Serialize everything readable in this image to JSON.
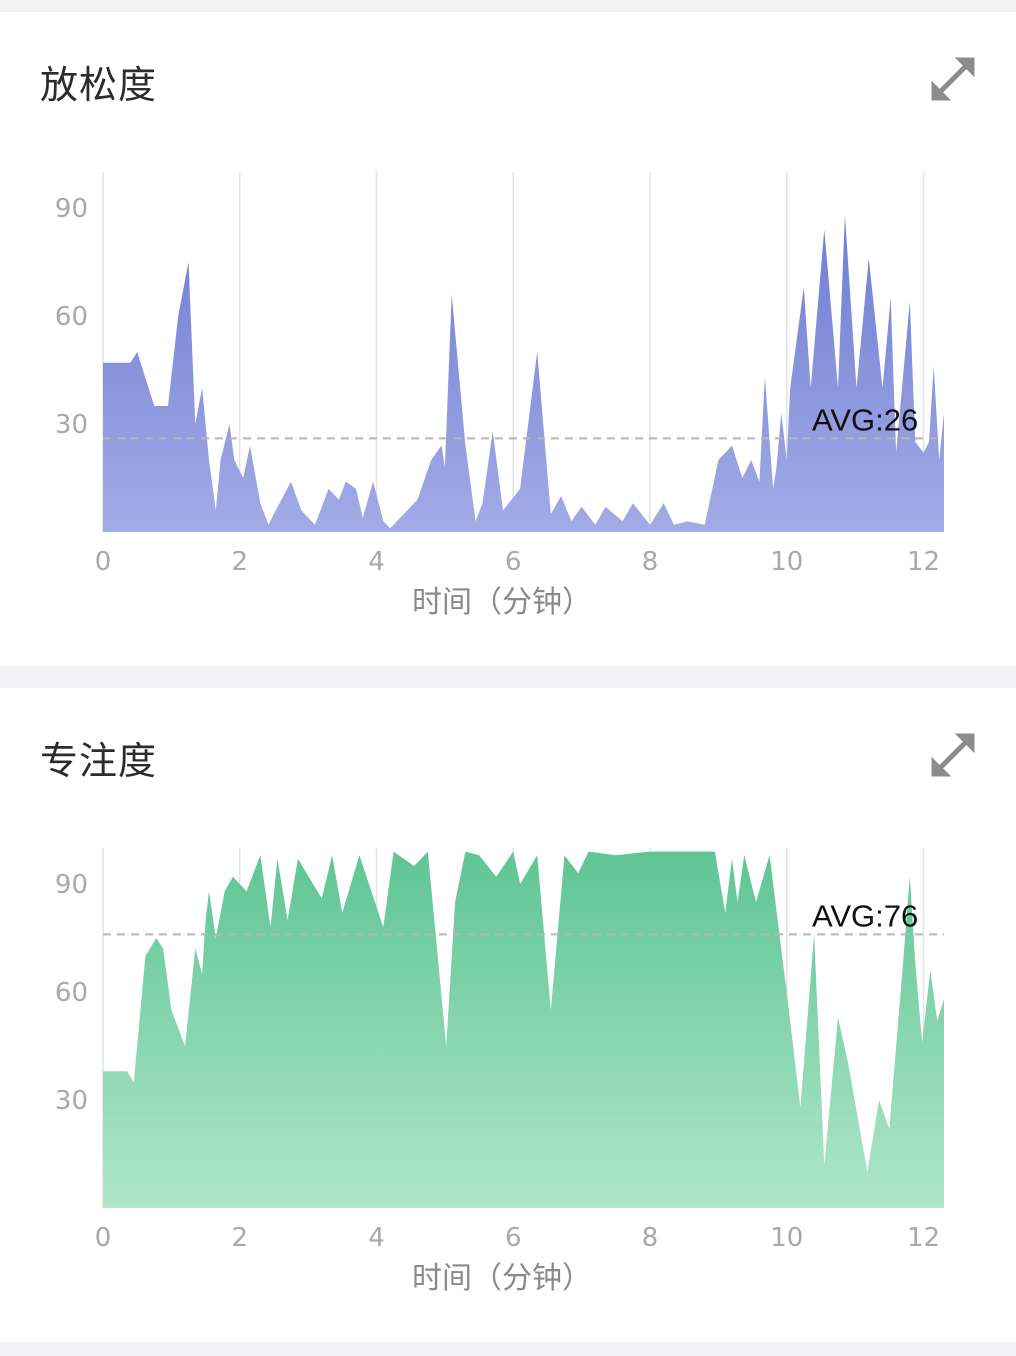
{
  "colors": {
    "relax_top": "#6f7dd3",
    "relax_bottom": "#a3abe5",
    "focus_top": "#5fc595",
    "focus_bottom": "#b0e6cb",
    "avg_line": "#b5b5b5",
    "grid": "#e3e3e3"
  },
  "cards": [
    {
      "title": "放松度",
      "expand_icon": "expand-arrows-icon",
      "chart_data": {
        "type": "area",
        "xlabel": "时间（分钟）",
        "ylabel": "",
        "xlim": [
          0,
          12.3
        ],
        "ylim": [
          0,
          100
        ],
        "xticks": [
          0,
          2,
          4,
          6,
          8,
          10,
          12
        ],
        "yticks": [
          30,
          60,
          90
        ],
        "avg_label": "AVG:26",
        "avg": 26,
        "series": [
          {
            "x": [
              0,
              0.4,
              0.5,
              0.75,
              0.95,
              1.1,
              1.25,
              1.35,
              1.45,
              1.55,
              1.65,
              1.72,
              1.85,
              1.92,
              2.05,
              2.15,
              2.3,
              2.42,
              2.5,
              2.75,
              2.9,
              3.1,
              3.3,
              3.45,
              3.55,
              3.7,
              3.8,
              3.95,
              4.1,
              4.2,
              4.35,
              4.6,
              4.8,
              4.95,
              5.0,
              5.1,
              5.3,
              5.45,
              5.55,
              5.7,
              5.85,
              6.1,
              6.35,
              6.55,
              6.7,
              6.85,
              7.0,
              7.2,
              7.35,
              7.6,
              7.75,
              8.0,
              8.2,
              8.35,
              8.55,
              8.8,
              9.0,
              9.2,
              9.35,
              9.48,
              9.6,
              9.68,
              9.8,
              9.85,
              9.92,
              10.0,
              10.05,
              10.25,
              10.35,
              10.55,
              10.75,
              10.85,
              11.02,
              11.2,
              11.4,
              11.52,
              11.6,
              11.8,
              11.88,
              12.0,
              12.08,
              12.15,
              12.23,
              12.3
            ],
            "values": [
              47,
              47,
              50,
              35,
              35,
              60,
              75,
              30,
              40,
              20,
              6,
              20,
              30,
              20,
              15,
              24,
              8,
              2,
              5,
              14,
              6,
              2,
              12,
              9,
              14,
              12,
              4,
              14,
              3,
              1,
              4,
              9,
              20,
              24,
              18,
              66,
              24,
              3,
              8,
              28,
              6,
              12,
              50,
              5,
              10,
              3,
              7,
              2,
              7,
              3,
              8,
              2,
              8,
              2,
              3,
              2,
              20,
              24,
              15,
              20,
              14,
              43,
              12,
              18,
              33,
              20,
              40,
              68,
              40,
              84,
              40,
              88,
              40,
              76,
              40,
              65,
              22,
              64,
              25,
              22,
              25,
              46,
              20,
              33
            ]
          }
        ]
      }
    },
    {
      "title": "专注度",
      "expand_icon": "expand-arrows-icon",
      "chart_data": {
        "type": "area",
        "xlabel": "时间（分钟）",
        "ylabel": "",
        "xlim": [
          0,
          12.3
        ],
        "ylim": [
          0,
          100
        ],
        "xticks": [
          0,
          2,
          4,
          6,
          8,
          10,
          12
        ],
        "yticks": [
          30,
          60,
          90
        ],
        "avg_label": "AVG:76",
        "avg": 76,
        "series": [
          {
            "x": [
              0,
              0.35,
              0.45,
              0.62,
              0.78,
              0.88,
              1.0,
              1.2,
              1.35,
              1.45,
              1.5,
              1.55,
              1.65,
              1.78,
              1.9,
              2.1,
              2.3,
              2.45,
              2.55,
              2.7,
              2.85,
              3.2,
              3.35,
              3.5,
              3.75,
              4.1,
              4.25,
              4.55,
              4.75,
              5.02,
              5.15,
              5.3,
              5.5,
              5.75,
              6.0,
              6.1,
              6.35,
              6.55,
              6.75,
              6.95,
              7.1,
              7.5,
              8.0,
              8.5,
              8.95,
              9.1,
              9.2,
              9.28,
              9.38,
              9.55,
              9.75,
              9.9,
              10.0,
              10.2,
              10.4,
              10.55,
              10.75,
              10.9,
              11.05,
              11.18,
              11.35,
              11.5,
              11.7,
              11.8,
              11.88,
              11.98,
              12.1,
              12.2,
              12.3
            ],
            "values": [
              38,
              38,
              35,
              70,
              75,
              72,
              55,
              45,
              72,
              65,
              80,
              88,
              75,
              88,
              92,
              88,
              98,
              78,
              97,
              80,
              97,
              86,
              98,
              82,
              98,
              78,
              99,
              95,
              99,
              45,
              85,
              99,
              98,
              92,
              99,
              90,
              98,
              55,
              98,
              93,
              99,
              98,
              99,
              99,
              99,
              82,
              97,
              85,
              98,
              85,
              98,
              75,
              60,
              28,
              76,
              12,
              53,
              40,
              24,
              10,
              30,
              22,
              68,
              92,
              68,
              46,
              66,
              52,
              58
            ]
          }
        ]
      }
    }
  ]
}
